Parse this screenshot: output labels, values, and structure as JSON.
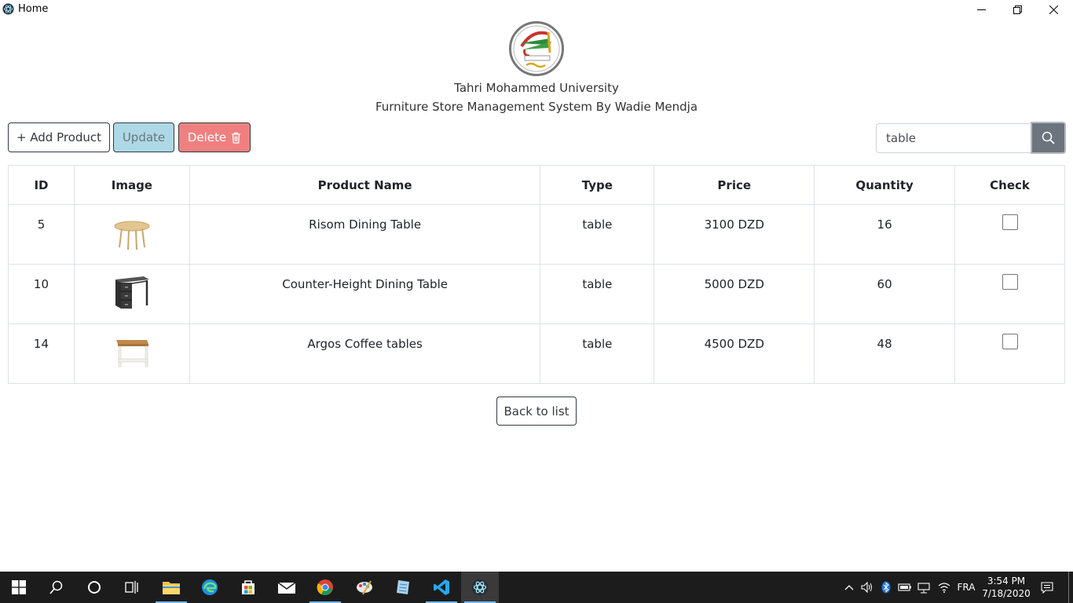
{
  "window": {
    "title": "Home"
  },
  "header": {
    "university": "Tahri Mohammed University",
    "system_title": "Furniture Store Management System By Wadie Mendja"
  },
  "toolbar": {
    "add_label": "+ Add Product",
    "update_label": "Update",
    "delete_label": "Delete"
  },
  "search": {
    "value": "table"
  },
  "table": {
    "columns": [
      "ID",
      "Image",
      "Product Name",
      "Type",
      "Price",
      "Quantity",
      "Check"
    ],
    "rows": [
      {
        "id": "5",
        "image": "round-wooden-table",
        "name": "Risom Dining Table",
        "type": "table",
        "price": "3100 DZD",
        "quantity": "16",
        "checked": false
      },
      {
        "id": "10",
        "image": "dark-desk-with-drawers",
        "name": "Counter-Height Dining Table",
        "type": "table",
        "price": "5000 DZD",
        "quantity": "60",
        "checked": false
      },
      {
        "id": "14",
        "image": "white-coffee-table",
        "name": "Argos Coffee tables",
        "type": "table",
        "price": "4500 DZD",
        "quantity": "48",
        "checked": false
      }
    ]
  },
  "back_label": "Back to list",
  "taskbar": {
    "language": "FRA",
    "time": "3:54 PM",
    "date": "7/18/2020"
  },
  "colors": {
    "update_bg": "#add8e6",
    "delete_bg": "#f08080",
    "search_btn": "#6c757d",
    "taskbar_bg": "#1c1c1c"
  }
}
